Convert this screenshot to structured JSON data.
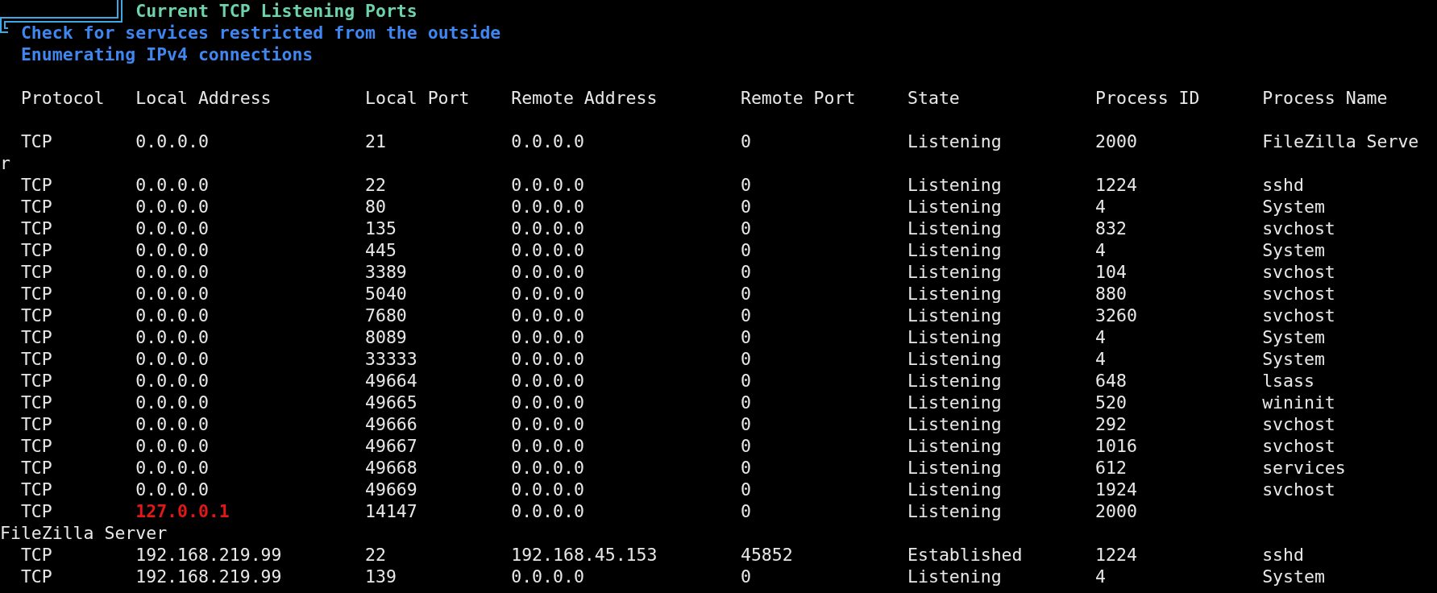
{
  "title": "Current TCP Listening Ports",
  "subtitle": "Check for services restricted from the outside",
  "info": "Enumerating IPv4 connections",
  "columns": [
    "Protocol",
    "Local Address",
    "Local Port",
    "Remote Address",
    "Remote Port",
    "State",
    "Process ID",
    "Process Name"
  ],
  "rows": [
    {
      "cells": [
        "TCP",
        "0.0.0.0",
        "21",
        "0.0.0.0",
        "0",
        "Listening",
        "2000",
        "FileZilla Serve"
      ],
      "flagged": false,
      "wrapped": "r"
    },
    {
      "cells": [
        "TCP",
        "0.0.0.0",
        "22",
        "0.0.0.0",
        "0",
        "Listening",
        "1224",
        "sshd"
      ],
      "flagged": false
    },
    {
      "cells": [
        "TCP",
        "0.0.0.0",
        "80",
        "0.0.0.0",
        "0",
        "Listening",
        "4",
        "System"
      ],
      "flagged": false
    },
    {
      "cells": [
        "TCP",
        "0.0.0.0",
        "135",
        "0.0.0.0",
        "0",
        "Listening",
        "832",
        "svchost"
      ],
      "flagged": false
    },
    {
      "cells": [
        "TCP",
        "0.0.0.0",
        "445",
        "0.0.0.0",
        "0",
        "Listening",
        "4",
        "System"
      ],
      "flagged": false
    },
    {
      "cells": [
        "TCP",
        "0.0.0.0",
        "3389",
        "0.0.0.0",
        "0",
        "Listening",
        "104",
        "svchost"
      ],
      "flagged": false
    },
    {
      "cells": [
        "TCP",
        "0.0.0.0",
        "5040",
        "0.0.0.0",
        "0",
        "Listening",
        "880",
        "svchost"
      ],
      "flagged": false
    },
    {
      "cells": [
        "TCP",
        "0.0.0.0",
        "7680",
        "0.0.0.0",
        "0",
        "Listening",
        "3260",
        "svchost"
      ],
      "flagged": false
    },
    {
      "cells": [
        "TCP",
        "0.0.0.0",
        "8089",
        "0.0.0.0",
        "0",
        "Listening",
        "4",
        "System"
      ],
      "flagged": false
    },
    {
      "cells": [
        "TCP",
        "0.0.0.0",
        "33333",
        "0.0.0.0",
        "0",
        "Listening",
        "4",
        "System"
      ],
      "flagged": false
    },
    {
      "cells": [
        "TCP",
        "0.0.0.0",
        "49664",
        "0.0.0.0",
        "0",
        "Listening",
        "648",
        "lsass"
      ],
      "flagged": false
    },
    {
      "cells": [
        "TCP",
        "0.0.0.0",
        "49665",
        "0.0.0.0",
        "0",
        "Listening",
        "520",
        "wininit"
      ],
      "flagged": false
    },
    {
      "cells": [
        "TCP",
        "0.0.0.0",
        "49666",
        "0.0.0.0",
        "0",
        "Listening",
        "292",
        "svchost"
      ],
      "flagged": false
    },
    {
      "cells": [
        "TCP",
        "0.0.0.0",
        "49667",
        "0.0.0.0",
        "0",
        "Listening",
        "1016",
        "svchost"
      ],
      "flagged": false
    },
    {
      "cells": [
        "TCP",
        "0.0.0.0",
        "49668",
        "0.0.0.0",
        "0",
        "Listening",
        "612",
        "services"
      ],
      "flagged": false
    },
    {
      "cells": [
        "TCP",
        "0.0.0.0",
        "49669",
        "0.0.0.0",
        "0",
        "Listening",
        "1924",
        "svchost"
      ],
      "flagged": false
    },
    {
      "cells": [
        "TCP",
        "127.0.0.1",
        "14147",
        "0.0.0.0",
        "0",
        "Listening",
        "2000"
      ],
      "flagged": true,
      "wrapped": "FileZilla Server"
    },
    {
      "cells": [
        "TCP",
        "192.168.219.99",
        "22",
        "192.168.45.153",
        "45852",
        "Established",
        "1224",
        "sshd"
      ],
      "flagged": false
    },
    {
      "cells": [
        "TCP",
        "192.168.219.99",
        "139",
        "0.0.0.0",
        "0",
        "Listening",
        "4",
        "System"
      ],
      "flagged": false
    }
  ]
}
